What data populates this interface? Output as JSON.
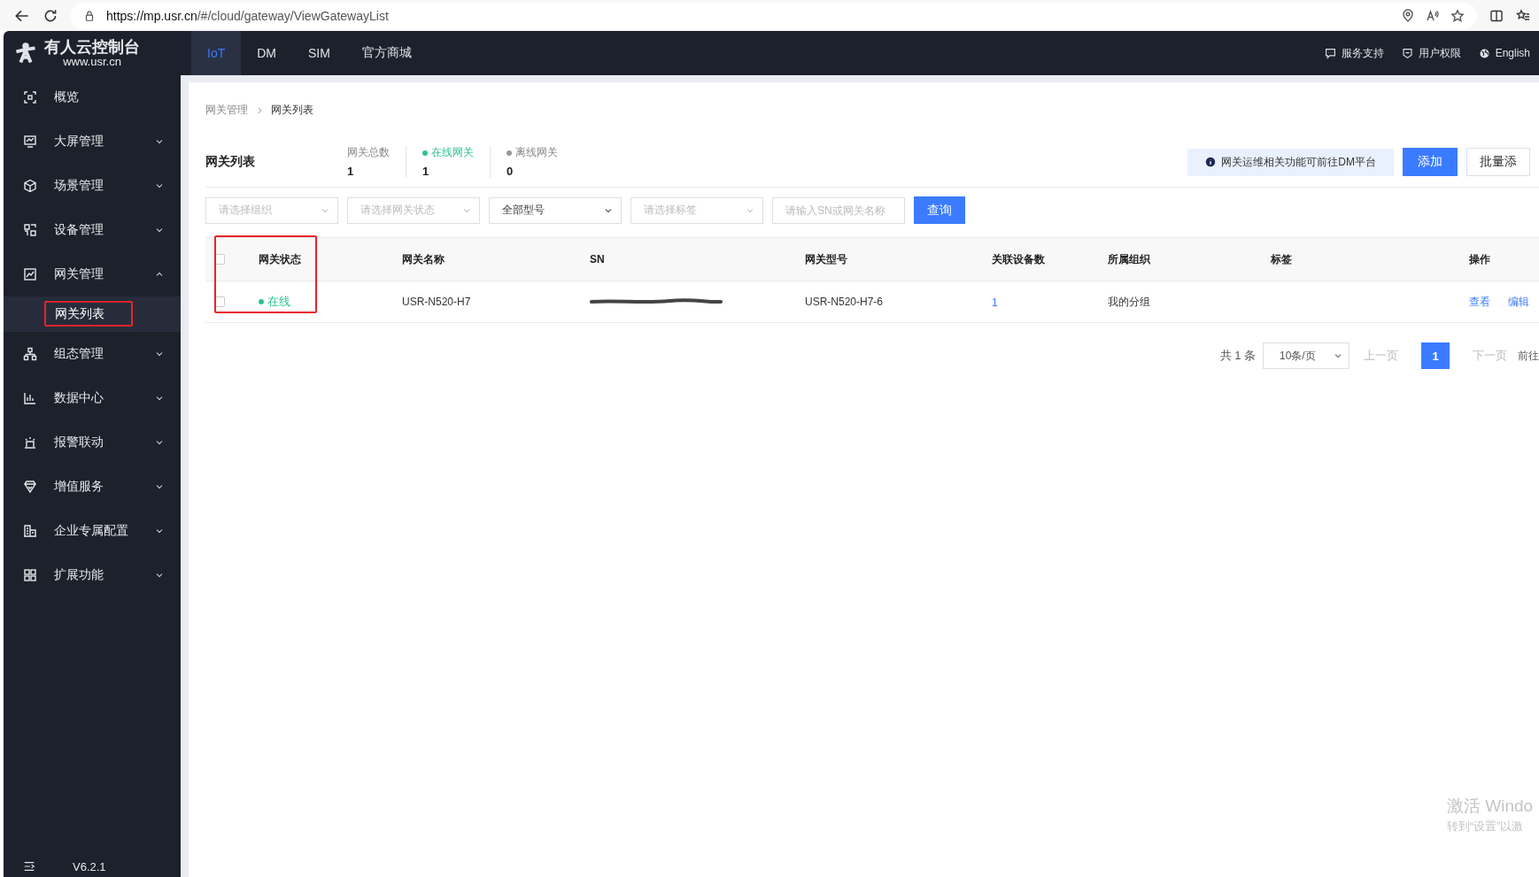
{
  "browser": {
    "url_host": "https://mp.usr.cn",
    "url_path": "/#/cloud/gateway/ViewGatewayList"
  },
  "nav": {
    "logo_title": "有人云控制台",
    "logo_site": "www.usr.cn",
    "tabs": [
      {
        "label": "IoT",
        "selected": true
      },
      {
        "label": "DM",
        "selected": false
      },
      {
        "label": "SIM",
        "selected": false
      },
      {
        "label": "官方商城",
        "selected": false
      }
    ],
    "links": [
      {
        "label": "服务支持",
        "kind": "chat"
      },
      {
        "label": "用户权限",
        "kind": "shield"
      },
      {
        "label": "English",
        "kind": "globe"
      }
    ]
  },
  "sidebar": {
    "items": [
      {
        "label": "概览",
        "kind": "overview"
      },
      {
        "label": "大屏管理",
        "kind": "screen",
        "expanded": false
      },
      {
        "label": "场景管理",
        "kind": "cube",
        "expanded": false
      },
      {
        "label": "设备管理",
        "kind": "device",
        "expanded": false
      },
      {
        "label": "网关管理",
        "kind": "chart",
        "expanded": true,
        "children": [
          {
            "label": "网关列表",
            "selected": true,
            "highlighted": true
          }
        ]
      },
      {
        "label": "组态管理",
        "kind": "topology",
        "expanded": false
      },
      {
        "label": "数据中心",
        "kind": "bars",
        "expanded": false
      },
      {
        "label": "报警联动",
        "kind": "alarm",
        "expanded": false
      },
      {
        "label": "增值服务",
        "kind": "diamond",
        "expanded": false
      },
      {
        "label": "企业专属配置",
        "kind": "building",
        "expanded": false
      },
      {
        "label": "扩展功能",
        "kind": "grid",
        "expanded": false
      }
    ],
    "version": "V6.2.1"
  },
  "breadcrumb": [
    "网关管理",
    "网关列表"
  ],
  "header": {
    "title": "网关列表",
    "stats": [
      {
        "label": "网关总数",
        "value": "1"
      },
      {
        "label": "在线网关",
        "value": "1",
        "color": "#2fc28b"
      },
      {
        "label": "离线网关",
        "value": "0",
        "color": "#999999"
      }
    ],
    "notice": "网关运维相关功能可前往DM平台",
    "buttons": [
      {
        "label": "添加",
        "kind": "primary"
      },
      {
        "label": "批量添",
        "kind": "default"
      }
    ]
  },
  "filters": [
    {
      "kind": "select",
      "placeholder": "请选择组织"
    },
    {
      "kind": "select",
      "placeholder": "请选择网关状态"
    },
    {
      "kind": "select",
      "value": "全部型号"
    },
    {
      "kind": "select",
      "placeholder": "请选择标签"
    },
    {
      "kind": "input",
      "placeholder": "请输入SN或网关名称"
    }
  ],
  "query_button": "查询",
  "table": {
    "select_all_checked": false,
    "columns": [
      {
        "label": "网关状态",
        "highlighted": true
      },
      {
        "label": "网关名称"
      },
      {
        "label": "SN"
      },
      {
        "label": "网关型号"
      },
      {
        "label": "关联设备数"
      },
      {
        "label": "所属组织"
      },
      {
        "label": "标签"
      },
      {
        "label": "操作"
      }
    ],
    "rows": [
      {
        "checked": false,
        "cells": [
          {
            "kind": "status",
            "text": "在线",
            "color": "#2fc28b"
          },
          {
            "kind": "text",
            "text": "USR-N520-H7"
          },
          {
            "kind": "redacted"
          },
          {
            "kind": "text",
            "text": "USR-N520-H7-6"
          },
          {
            "kind": "link",
            "text": "1"
          },
          {
            "kind": "text",
            "text": "我的分组"
          },
          {
            "kind": "empty"
          },
          {
            "kind": "actions",
            "actions": [
              "查看",
              "编辑"
            ]
          }
        ]
      }
    ]
  },
  "pagination": {
    "total": "共 1 条",
    "page_size": "10条/页",
    "prev": "上一页",
    "pages": [
      {
        "label": "1",
        "selected": true
      }
    ],
    "next": "下一页",
    "goto": "前往"
  },
  "os_watermark": {
    "line1": "激活 Windo",
    "line2": "转到“设置”以激"
  }
}
